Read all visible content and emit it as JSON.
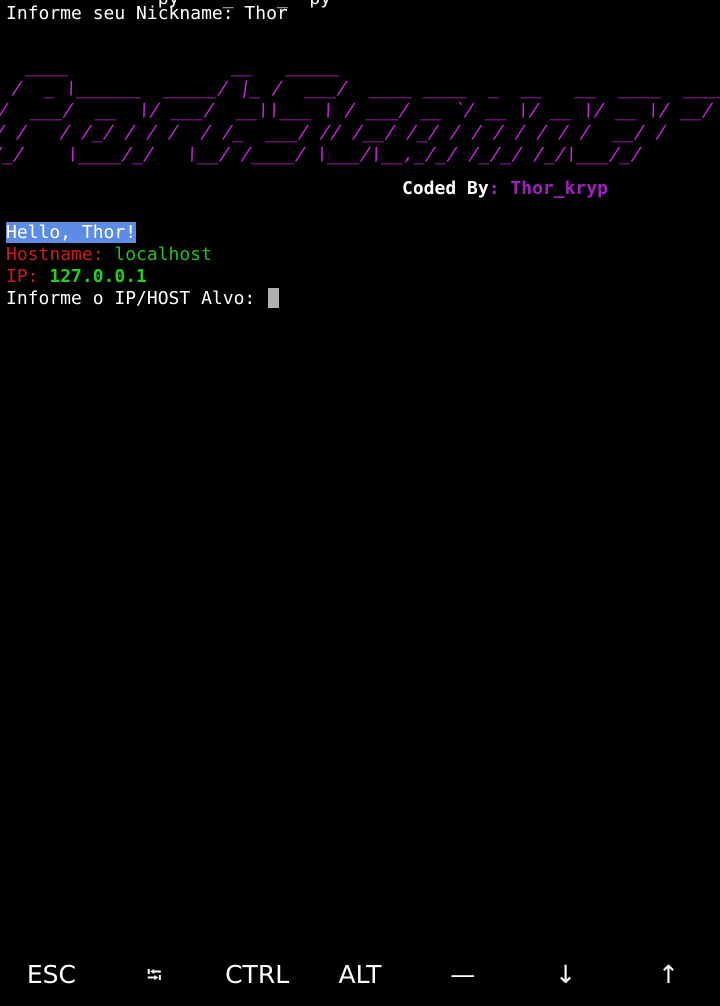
{
  "terminal": {
    "previous_command": "     ~       ~py    _    _  py",
    "nickname_prompt": "Informe seu Nickname: ",
    "nickname_value": "Thor",
    "banner": "  ____               __   _____\n /  _ \\______  _____/ |_ /  ___/  ____ ____  _  __   __  ____  ____\n/  ___/  __  \\/ ___/  __\\\\___ \\ / ___/ __ `/ __ \\/ __ \\/ __ \\/ __/\n/ /   / /_/ / / /  / /_  ___/ // /__/ /_/ / / / / / / /  __/ /\n/_/    \\____/_/   \\__/ /____/ \\___/\\__,_/_/ /_/_/ /_/\\___/_/",
    "coded_by_label": "Coded By",
    "coded_by_colon": ": ",
    "author": "Thor_kryp",
    "hello": "Hello, Thor!",
    "hostname_label": "Hostname: ",
    "hostname_value": "localhost",
    "ip_label": "IP: ",
    "ip_value": "127.0.0.1",
    "target_prompt": "Informe o IP/HOST Alvo: "
  },
  "extra_keys": {
    "esc": "ESC",
    "tab": "⭾",
    "ctrl": "CTRL",
    "alt": "ALT",
    "dash": "—",
    "down": "↓",
    "up": "↑"
  },
  "colors": {
    "banner": "#cc22dd",
    "author": "#a020c0",
    "hostname_label": "#d01a1a",
    "hostname_value": "#22c022",
    "ip_value": "#22d022",
    "hello_highlight": "#5c8ce6"
  }
}
